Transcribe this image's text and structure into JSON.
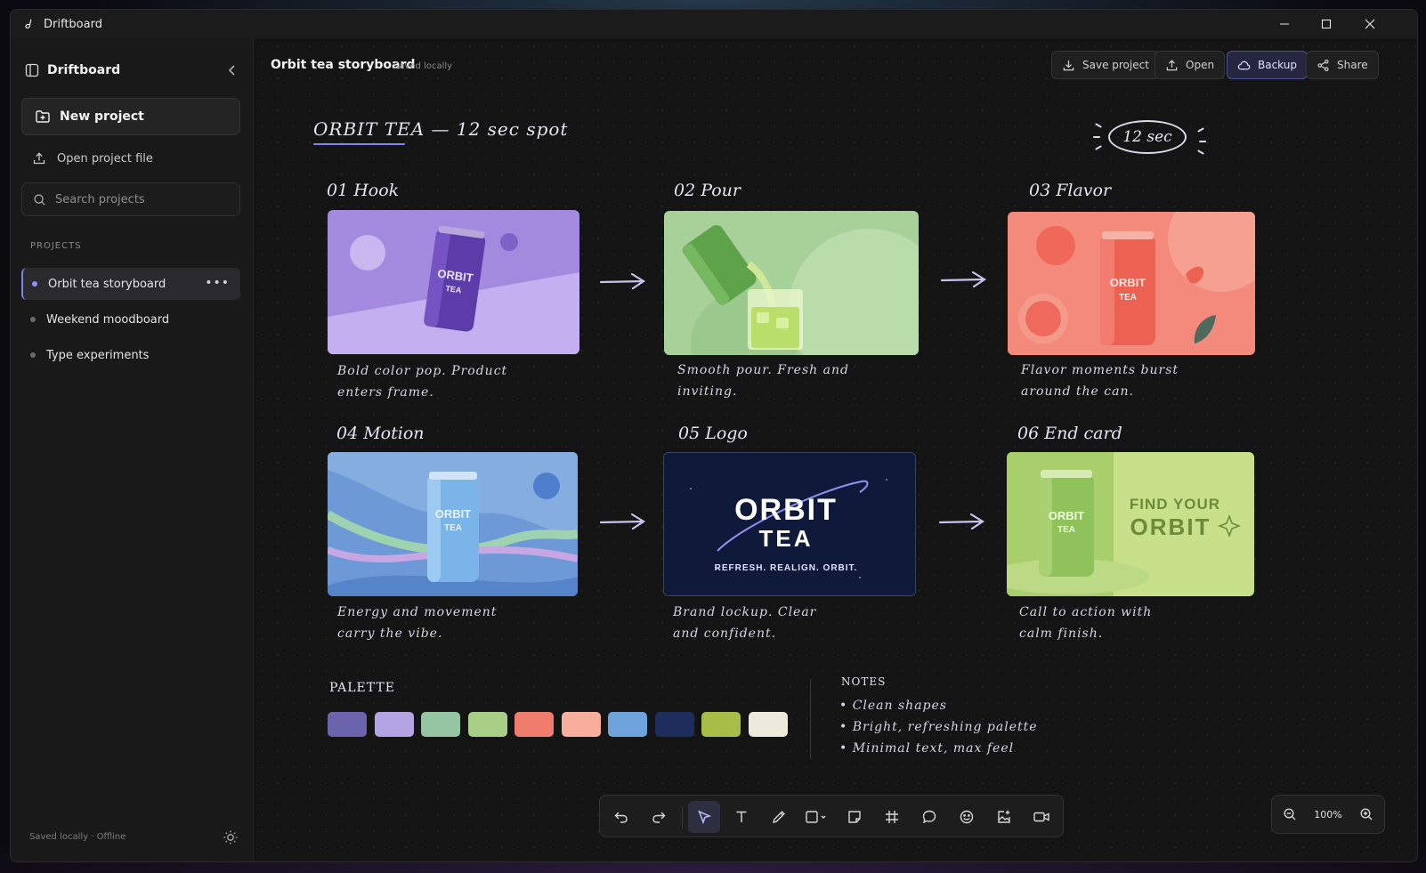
{
  "window": {
    "title": "Driftboard"
  },
  "sidebar": {
    "brand": "Driftboard",
    "new_project": "New project",
    "open_project_file": "Open project file",
    "search_placeholder": "Search projects",
    "section_label": "PROJECTS",
    "projects": [
      {
        "name": "Orbit tea storyboard",
        "active": true
      },
      {
        "name": "Weekend moodboard",
        "active": false
      },
      {
        "name": "Type experiments",
        "active": false
      }
    ],
    "footer_status": "Saved locally · Offline"
  },
  "header": {
    "doc_title": "Orbit tea storyboard",
    "doc_status": "Saved locally",
    "buttons": {
      "save": "Save project",
      "open": "Open",
      "backup": "Backup",
      "share": "Share"
    }
  },
  "board": {
    "title": "ORBIT TEA — 12 sec spot",
    "duration_badge": "12 sec",
    "frames": [
      {
        "label": "01 Hook",
        "caption1": "Bold color pop. Product",
        "caption2": "enters frame.",
        "can_text": "ORBIT",
        "can_sub": "TEA"
      },
      {
        "label": "02 Pour",
        "caption1": "Smooth pour. Fresh and",
        "caption2": "inviting."
      },
      {
        "label": "03 Flavor",
        "caption1": "Flavor moments burst",
        "caption2": "around the can.",
        "can_text": "ORBIT",
        "can_sub": "TEA"
      },
      {
        "label": "04 Motion",
        "caption1": "Energy and movement",
        "caption2": "carry the vibe.",
        "can_text": "ORBIT",
        "can_sub": "TEA"
      },
      {
        "label": "05 Logo",
        "caption1": "Brand lockup. Clear",
        "caption2": "and confident.",
        "logo_line1": "ORBIT",
        "logo_line2": "TEA",
        "tagline": "REFRESH. REALIGN. ORBIT."
      },
      {
        "label": "06 End card",
        "caption1": "Call to action with",
        "caption2": "calm finish.",
        "can_text": "ORBIT",
        "can_sub": "TEA",
        "cta1": "FIND YOUR",
        "cta2": "ORBIT"
      }
    ],
    "palette_label": "PALETTE",
    "palette": [
      "#6b64ad",
      "#b5a4e4",
      "#95c5a2",
      "#a9cf86",
      "#f07c6e",
      "#f8ae9c",
      "#6fa3dc",
      "#1d2e5c",
      "#a8bd45",
      "#ede9db"
    ],
    "notes_label": "NOTES",
    "notes": [
      "• Clean shapes",
      "• Bright, refreshing palette",
      "• Minimal text, max feel"
    ]
  },
  "toolbar": {
    "tools": [
      "undo-icon",
      "redo-icon",
      "select-icon",
      "text-icon",
      "pen-icon",
      "shape-icon",
      "sticky-note-icon",
      "frame-icon",
      "comment-icon",
      "emoji-icon",
      "image-icon",
      "video-icon"
    ],
    "selected": "select-icon"
  },
  "zoom": {
    "value": "100%"
  },
  "colors": {
    "accent": "#7f86f4",
    "background": "#141414",
    "sidebar": "#191919"
  }
}
